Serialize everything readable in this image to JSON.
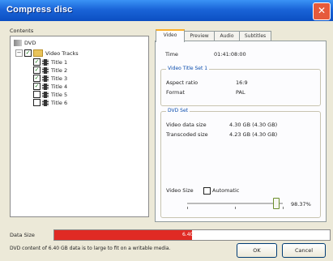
{
  "window": {
    "title": "Compress disc"
  },
  "contents": {
    "label": "Contents",
    "tree": {
      "root": "DVD",
      "folder": "Video Tracks",
      "items": [
        "Title 1",
        "Title 2",
        "Title 3",
        "Title 4",
        "Title 5",
        "Title 6"
      ],
      "checked": [
        true,
        true,
        true,
        true,
        false,
        false
      ]
    }
  },
  "tabs": [
    {
      "label": "Video",
      "active": true
    },
    {
      "label": "Preview",
      "active": false
    },
    {
      "label": "Audio",
      "active": false
    },
    {
      "label": "Subtitles",
      "active": false
    }
  ],
  "video": {
    "time_label": "Time",
    "time_value": "01:41:08:00",
    "group1_title": "Video Title Set 1",
    "aspect_label": "Aspect ratio",
    "aspect_value": "16:9",
    "format_label": "Format",
    "format_value": "PAL",
    "group2_title": "DVD Set",
    "data_size_label": "Video data size",
    "data_size_value": "4.30 GB (4.30 GB)",
    "transcoded_label": "Transcoded size",
    "transcoded_value": "4.23 GB (4.30 GB)",
    "size_label": "Video Size",
    "auto_label": "Automatic",
    "auto_checked": false,
    "percent": "98.37%",
    "slider_fraction": 0.92
  },
  "footer": {
    "data_size_label": "Data Size",
    "data_size_value": "6.40 GB",
    "data_fraction": 0.5,
    "status": "DVD content of 6.40 GB data is to large to fit on a writable media.",
    "ok_label": "OK",
    "cancel_label": "Cancel"
  },
  "colors": {
    "bar_fill": "#e02a24",
    "title_bar": "#1a64d8",
    "accent_blue": "#0b4dad"
  }
}
